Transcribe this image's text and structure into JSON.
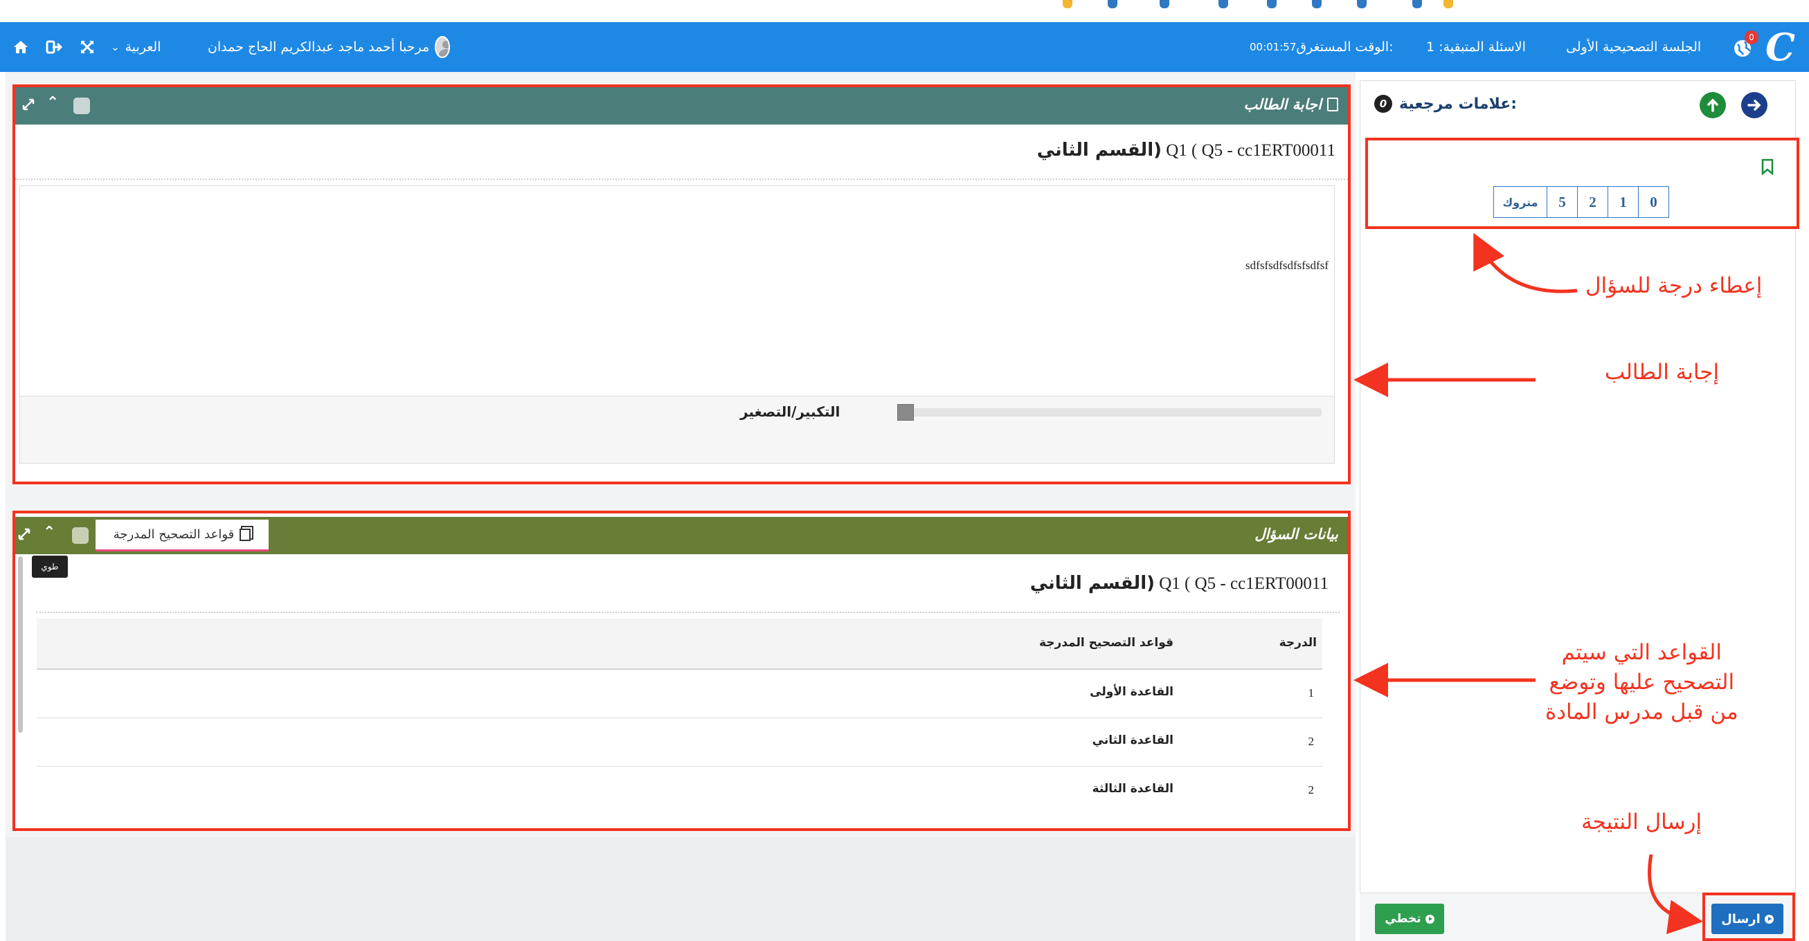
{
  "colors": {
    "header_blue": "#1e88e5",
    "answer_head": "#4b7d7a",
    "question_head": "#687d36",
    "highlight_red": "#f2331f",
    "send_blue": "#1e6fc0",
    "skip_green": "#2e9e4f"
  },
  "header": {
    "notification_count": "0",
    "session_label": "الجلسة التصحيحية الأولى",
    "remaining_label": "الاسئلة المتبقية: 1",
    "time_label": "الوقت المستغرق:",
    "time_value": "00:01:57",
    "welcome": "مرحبا أحمد ماجد عبدالكريم الحاج حمدان",
    "language": "العربية",
    "icons": [
      "home-icon",
      "logout-icon",
      "fullscreen-icon"
    ]
  },
  "answer_panel": {
    "title": "اجابة الطالب",
    "question_code": "Q1 ( Q5 - cc1ERT00011",
    "question_section": "القسم الثاني)",
    "answer_text": "sdfsfsdfsdfsfsdfsf",
    "zoom_label": "التكبير/التصغير"
  },
  "question_panel": {
    "title": "بيانات السؤال",
    "rubric_tab": "قواعد التصحيح المدرجة",
    "collapse_tooltip": "طوي",
    "question_code": "Q1 ( Q5 - cc1ERT00011",
    "question_section": "القسم الثاني)",
    "table": {
      "headers": [
        "الدرجة",
        "قواعد التصحيح المدرجة"
      ],
      "rows": [
        {
          "score": "1",
          "rule": "القاعدة الأولى"
        },
        {
          "score": "2",
          "rule": "القاعدة الثاني"
        },
        {
          "score": "2",
          "rule": "القاعدة الثالثة"
        }
      ]
    }
  },
  "grading_panel": {
    "bookmarks_label": "علامات مرجعية:",
    "bookmarks_count": "0",
    "scores": [
      "0",
      "1",
      "2",
      "5",
      "متروك"
    ],
    "send_label": "ارسال",
    "skip_label": "تخطي"
  },
  "annotations": {
    "give_score": "إعطاء درجة للسؤال",
    "student_answer": "إجابة الطالب",
    "rules_line1": "القواعد التي سيتم",
    "rules_line2": "التصحيح عليها وتوضع",
    "rules_line3": "من قبل مدرس المادة",
    "send_result": "إرسال النتيجة"
  }
}
